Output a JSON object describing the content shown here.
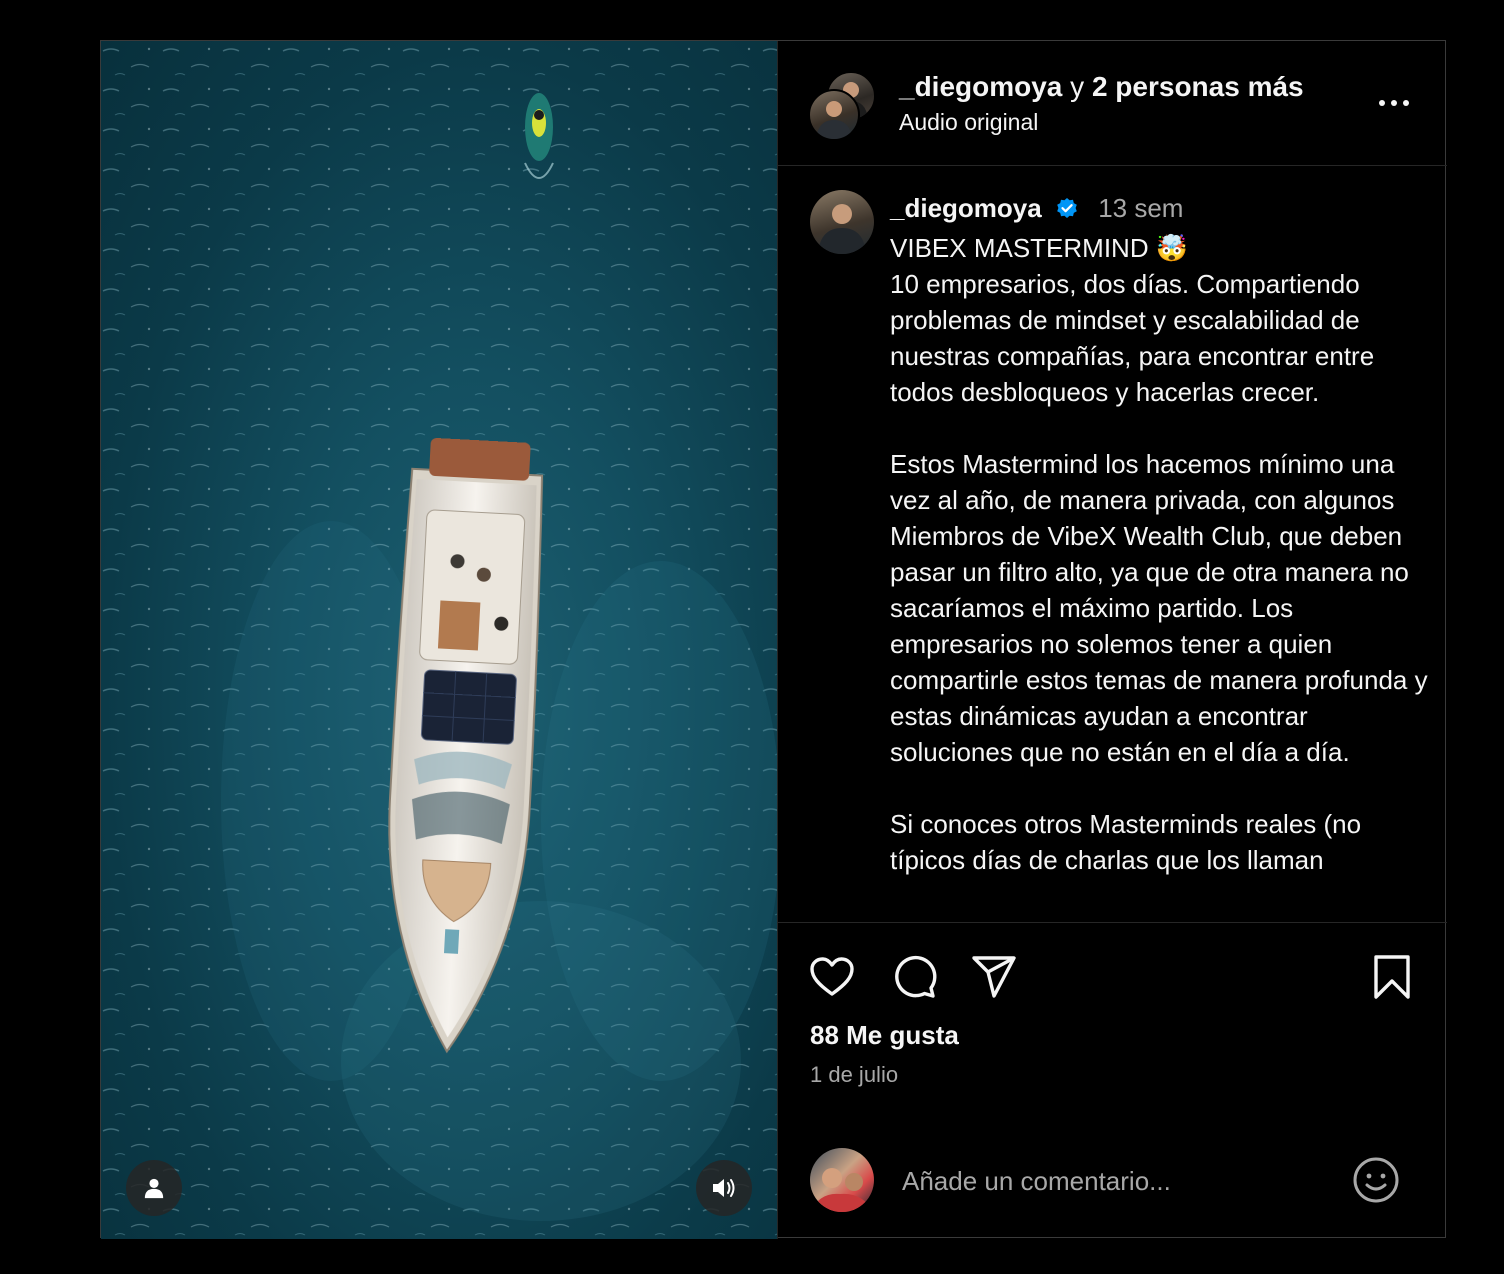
{
  "header": {
    "username": "_diegomoya",
    "connector": "y",
    "others": "2 personas más",
    "audio": "Audio original",
    "more_icon": "more-horizontal-icon"
  },
  "caption": {
    "username": "_diegomoya",
    "verified": true,
    "time": "13 sem",
    "text": "VIBEX MASTERMIND 🤯\n10 empresarios, dos días. Compartiendo problemas de mindset y escalabilidad de nuestras compañías, para encontrar entre todos desbloqueos y hacerlas crecer.\n\nEstos Mastermind los hacemos mínimo una vez al año, de manera privada, con algunos Miembros de VibeX Wealth Club, que deben pasar un filtro alto, ya que de otra manera no sacaríamos el máximo partido. Los empresarios no solemos tener a quien compartirle estos temas de manera profunda y estas dinámicas ayudan a encontrar soluciones que no están en el día a día.\n\nSi conoces otros Masterminds reales (no típicos días de charlas que los llaman"
  },
  "actions": {
    "like_icon": "heart-icon",
    "comment_icon": "comment-icon",
    "share_icon": "send-icon",
    "save_icon": "bookmark-icon"
  },
  "likes": "88 Me gusta",
  "date": "1 de julio",
  "comment": {
    "placeholder": "Añade un comentario...",
    "emoji_icon": "emoji-icon"
  },
  "media": {
    "tag_icon": "user-tag-icon",
    "sound_icon": "volume-icon"
  },
  "colors": {
    "background": "#000000",
    "text": "#f5f5f5",
    "secondary_text": "#a8a8a8",
    "verified": "#0095f6",
    "sea": "#134f60"
  }
}
